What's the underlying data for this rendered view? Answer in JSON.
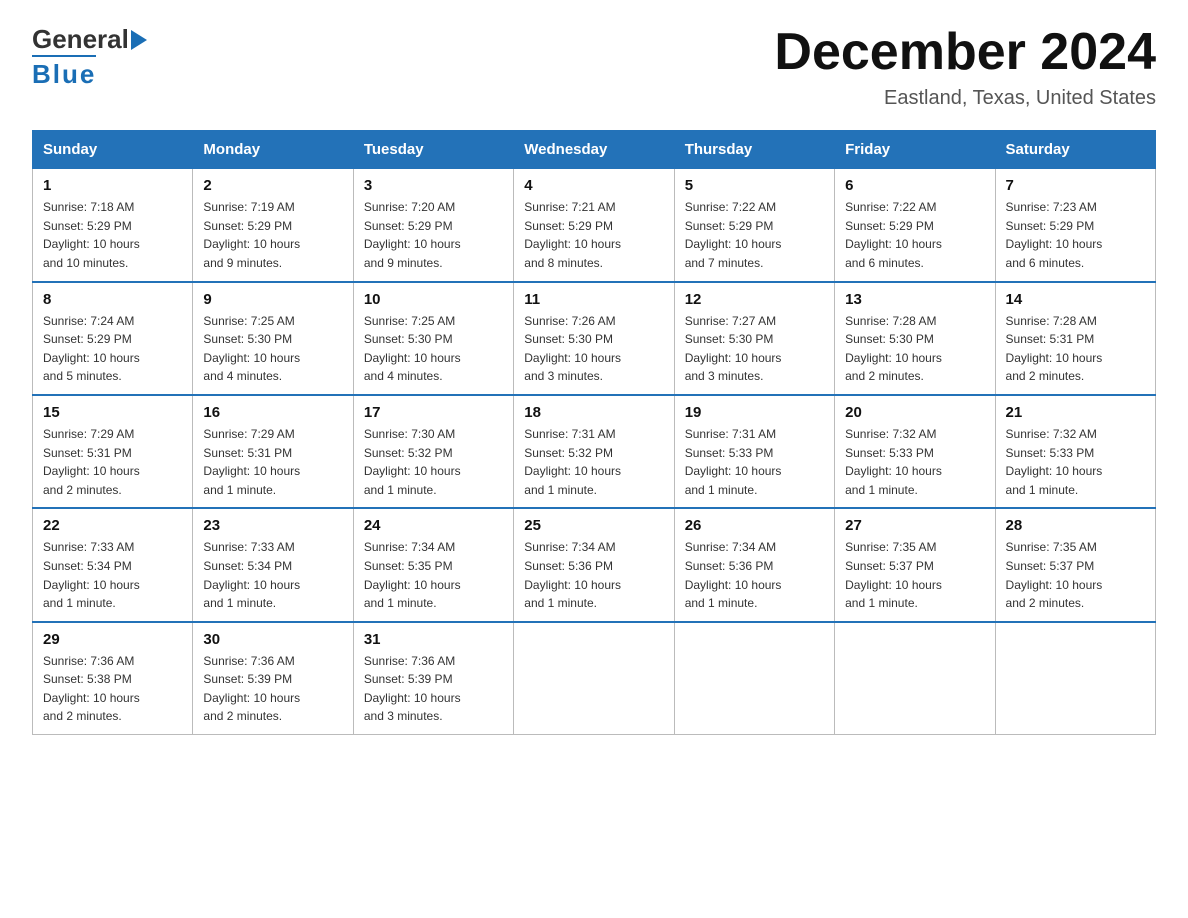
{
  "header": {
    "month_year": "December 2024",
    "location": "Eastland, Texas, United States",
    "logo_general": "General",
    "logo_blue": "Blue"
  },
  "days_of_week": [
    "Sunday",
    "Monday",
    "Tuesday",
    "Wednesday",
    "Thursday",
    "Friday",
    "Saturday"
  ],
  "weeks": [
    [
      {
        "day": "1",
        "sunrise": "7:18 AM",
        "sunset": "5:29 PM",
        "daylight": "10 hours and 10 minutes."
      },
      {
        "day": "2",
        "sunrise": "7:19 AM",
        "sunset": "5:29 PM",
        "daylight": "10 hours and 9 minutes."
      },
      {
        "day": "3",
        "sunrise": "7:20 AM",
        "sunset": "5:29 PM",
        "daylight": "10 hours and 9 minutes."
      },
      {
        "day": "4",
        "sunrise": "7:21 AM",
        "sunset": "5:29 PM",
        "daylight": "10 hours and 8 minutes."
      },
      {
        "day": "5",
        "sunrise": "7:22 AM",
        "sunset": "5:29 PM",
        "daylight": "10 hours and 7 minutes."
      },
      {
        "day": "6",
        "sunrise": "7:22 AM",
        "sunset": "5:29 PM",
        "daylight": "10 hours and 6 minutes."
      },
      {
        "day": "7",
        "sunrise": "7:23 AM",
        "sunset": "5:29 PM",
        "daylight": "10 hours and 6 minutes."
      }
    ],
    [
      {
        "day": "8",
        "sunrise": "7:24 AM",
        "sunset": "5:29 PM",
        "daylight": "10 hours and 5 minutes."
      },
      {
        "day": "9",
        "sunrise": "7:25 AM",
        "sunset": "5:30 PM",
        "daylight": "10 hours and 4 minutes."
      },
      {
        "day": "10",
        "sunrise": "7:25 AM",
        "sunset": "5:30 PM",
        "daylight": "10 hours and 4 minutes."
      },
      {
        "day": "11",
        "sunrise": "7:26 AM",
        "sunset": "5:30 PM",
        "daylight": "10 hours and 3 minutes."
      },
      {
        "day": "12",
        "sunrise": "7:27 AM",
        "sunset": "5:30 PM",
        "daylight": "10 hours and 3 minutes."
      },
      {
        "day": "13",
        "sunrise": "7:28 AM",
        "sunset": "5:30 PM",
        "daylight": "10 hours and 2 minutes."
      },
      {
        "day": "14",
        "sunrise": "7:28 AM",
        "sunset": "5:31 PM",
        "daylight": "10 hours and 2 minutes."
      }
    ],
    [
      {
        "day": "15",
        "sunrise": "7:29 AM",
        "sunset": "5:31 PM",
        "daylight": "10 hours and 2 minutes."
      },
      {
        "day": "16",
        "sunrise": "7:29 AM",
        "sunset": "5:31 PM",
        "daylight": "10 hours and 1 minute."
      },
      {
        "day": "17",
        "sunrise": "7:30 AM",
        "sunset": "5:32 PM",
        "daylight": "10 hours and 1 minute."
      },
      {
        "day": "18",
        "sunrise": "7:31 AM",
        "sunset": "5:32 PM",
        "daylight": "10 hours and 1 minute."
      },
      {
        "day": "19",
        "sunrise": "7:31 AM",
        "sunset": "5:33 PM",
        "daylight": "10 hours and 1 minute."
      },
      {
        "day": "20",
        "sunrise": "7:32 AM",
        "sunset": "5:33 PM",
        "daylight": "10 hours and 1 minute."
      },
      {
        "day": "21",
        "sunrise": "7:32 AM",
        "sunset": "5:33 PM",
        "daylight": "10 hours and 1 minute."
      }
    ],
    [
      {
        "day": "22",
        "sunrise": "7:33 AM",
        "sunset": "5:34 PM",
        "daylight": "10 hours and 1 minute."
      },
      {
        "day": "23",
        "sunrise": "7:33 AM",
        "sunset": "5:34 PM",
        "daylight": "10 hours and 1 minute."
      },
      {
        "day": "24",
        "sunrise": "7:34 AM",
        "sunset": "5:35 PM",
        "daylight": "10 hours and 1 minute."
      },
      {
        "day": "25",
        "sunrise": "7:34 AM",
        "sunset": "5:36 PM",
        "daylight": "10 hours and 1 minute."
      },
      {
        "day": "26",
        "sunrise": "7:34 AM",
        "sunset": "5:36 PM",
        "daylight": "10 hours and 1 minute."
      },
      {
        "day": "27",
        "sunrise": "7:35 AM",
        "sunset": "5:37 PM",
        "daylight": "10 hours and 1 minute."
      },
      {
        "day": "28",
        "sunrise": "7:35 AM",
        "sunset": "5:37 PM",
        "daylight": "10 hours and 2 minutes."
      }
    ],
    [
      {
        "day": "29",
        "sunrise": "7:36 AM",
        "sunset": "5:38 PM",
        "daylight": "10 hours and 2 minutes."
      },
      {
        "day": "30",
        "sunrise": "7:36 AM",
        "sunset": "5:39 PM",
        "daylight": "10 hours and 2 minutes."
      },
      {
        "day": "31",
        "sunrise": "7:36 AM",
        "sunset": "5:39 PM",
        "daylight": "10 hours and 3 minutes."
      },
      null,
      null,
      null,
      null
    ]
  ],
  "labels": {
    "sunrise": "Sunrise:",
    "sunset": "Sunset:",
    "daylight": "Daylight:"
  }
}
